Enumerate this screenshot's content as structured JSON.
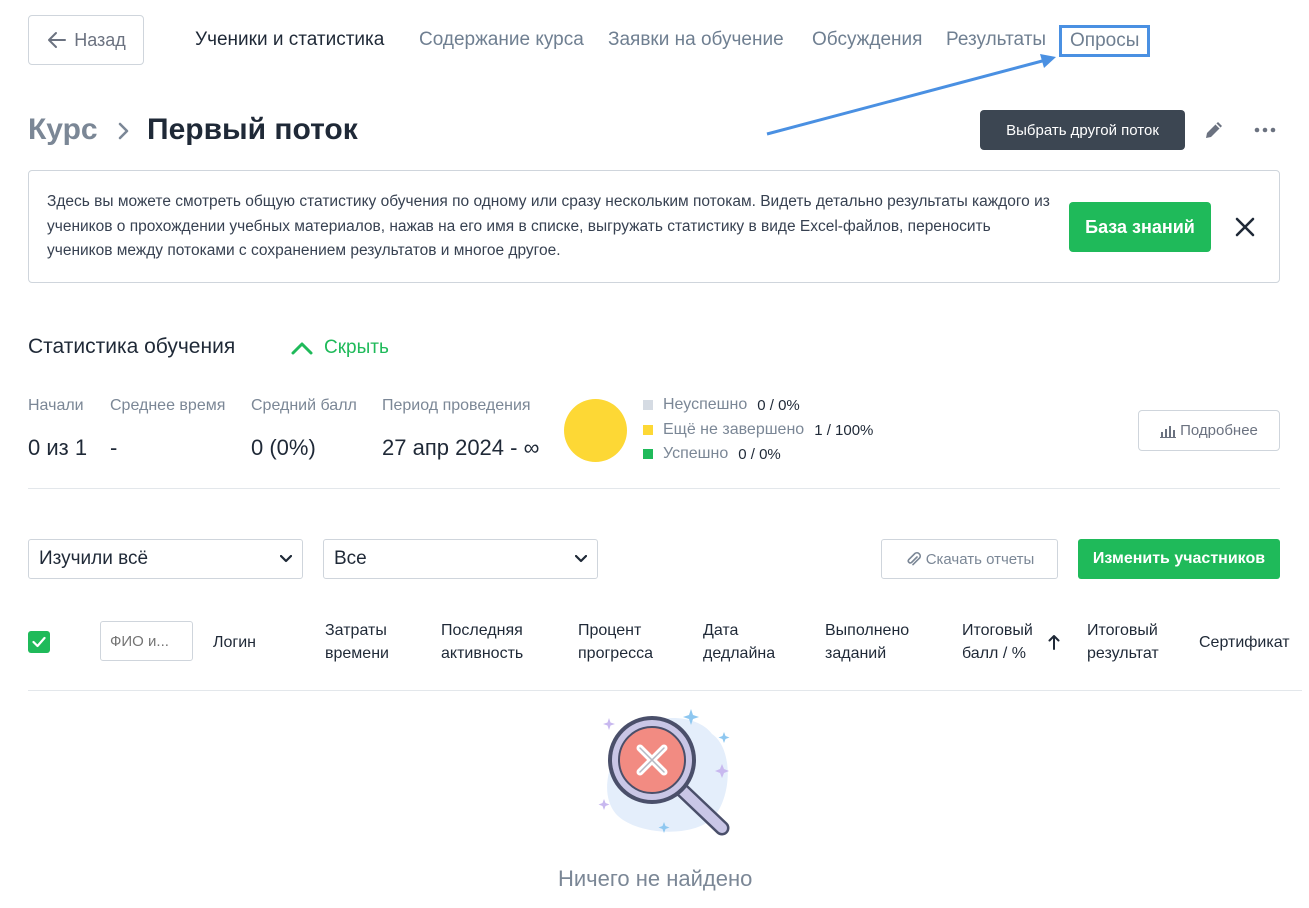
{
  "nav": {
    "back_label": "Назад",
    "tabs": [
      {
        "label": "Ученики и статистика",
        "state": "active"
      },
      {
        "label": "Содержание курса",
        "state": "normal"
      },
      {
        "label": "Заявки на обучение",
        "state": "normal"
      },
      {
        "label": "Обсуждения",
        "state": "normal"
      },
      {
        "label": "Результаты",
        "state": "normal"
      },
      {
        "label": "Опросы",
        "state": "highlighted"
      }
    ],
    "highlight_color": "#4a90e2"
  },
  "header": {
    "breadcrumb_root": "Курс",
    "breadcrumb_current": "Первый поток",
    "choose_stream_label": "Выбрать другой поток"
  },
  "info": {
    "text": "Здесь вы можете смотреть общую статистику обучения по одному или сразу нескольким потокам. Видеть детально результаты каждого из учеников о прохождении учебных материалов, нажав на его имя в списке, выгружать статистику в виде Excel-файлов, переносить учеников между потоками с сохранением результатов и многое другое.",
    "kb_button_label": "База знаний"
  },
  "stats": {
    "title": "Статистика обучения",
    "toggle_label": "Скрыть",
    "items": [
      {
        "label": "Начали",
        "value": "0 из 1"
      },
      {
        "label": "Среднее время",
        "value": "-"
      },
      {
        "label": "Средний балл",
        "value": "0 (0%)"
      },
      {
        "label": "Период проведения",
        "value": "27 апр 2024 - ∞"
      }
    ],
    "legend": [
      {
        "name": "Неуспешно",
        "value": "0 / 0%",
        "color": "#d5dbe3",
        "fraction": 0
      },
      {
        "name": "Ещё не завершено",
        "value": "1 / 100%",
        "color": "#fdd835",
        "fraction": 1
      },
      {
        "name": "Успешно",
        "value": "0 / 0%",
        "color": "#1fba5a",
        "fraction": 0
      }
    ],
    "details_label": "Подробнее"
  },
  "filters": {
    "status_select": "Изучили всё",
    "group_select": "Все",
    "download_label": "Скачать отчеты",
    "change_label": "Изменить участников"
  },
  "table": {
    "search_placeholder": "ФИО и...",
    "columns": [
      "Логин",
      "Затраты\nвремени",
      "Последняя\nактивность",
      "Процент\nпрогресса",
      "Дата\nдедлайна",
      "Выполнено\nзаданий",
      "Итоговый\nбалл / %",
      "Итоговый\nрезультат",
      "Сертификат"
    ]
  },
  "empty": {
    "text": "Ничего не найдено"
  },
  "colors": {
    "accent_green": "#1fba5a",
    "dark_button": "#3c4652",
    "muted_text": "#7b8796"
  }
}
